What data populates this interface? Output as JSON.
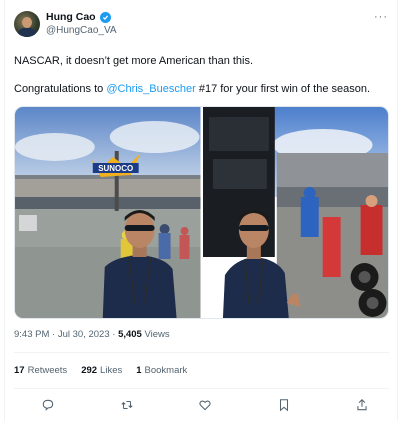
{
  "author": {
    "name": "Hung Cao",
    "handle": "@HungCao_VA",
    "verified_icon": "verified-badge-icon",
    "avatar_icon": "avatar"
  },
  "tweet": {
    "line1": "NASCAR, it doesn’t get more American than this.",
    "line2_prefix": "Congratulations to ",
    "mention": "@Chris_Buescher",
    "line2_suffix": " #17 for your first win of the season."
  },
  "media": {
    "photo_left": {
      "sign": "SUNOCO"
    },
    "photo_right": {}
  },
  "meta": {
    "time": "9:43 PM",
    "sep1": " · ",
    "date": "Jul 30, 2023",
    "sep2": " · ",
    "views_count": "5,405",
    "views_label": " Views"
  },
  "stats": {
    "retweets_count": "17",
    "retweets_label": "Retweets",
    "likes_count": "292",
    "likes_label": "Likes",
    "bookmarks_count": "1",
    "bookmarks_label": "Bookmark"
  },
  "menu_glyph": "···",
  "colors": {
    "accent": "#1d9bf0",
    "secondary_text": "#536471",
    "divider": "#eff3f4"
  }
}
